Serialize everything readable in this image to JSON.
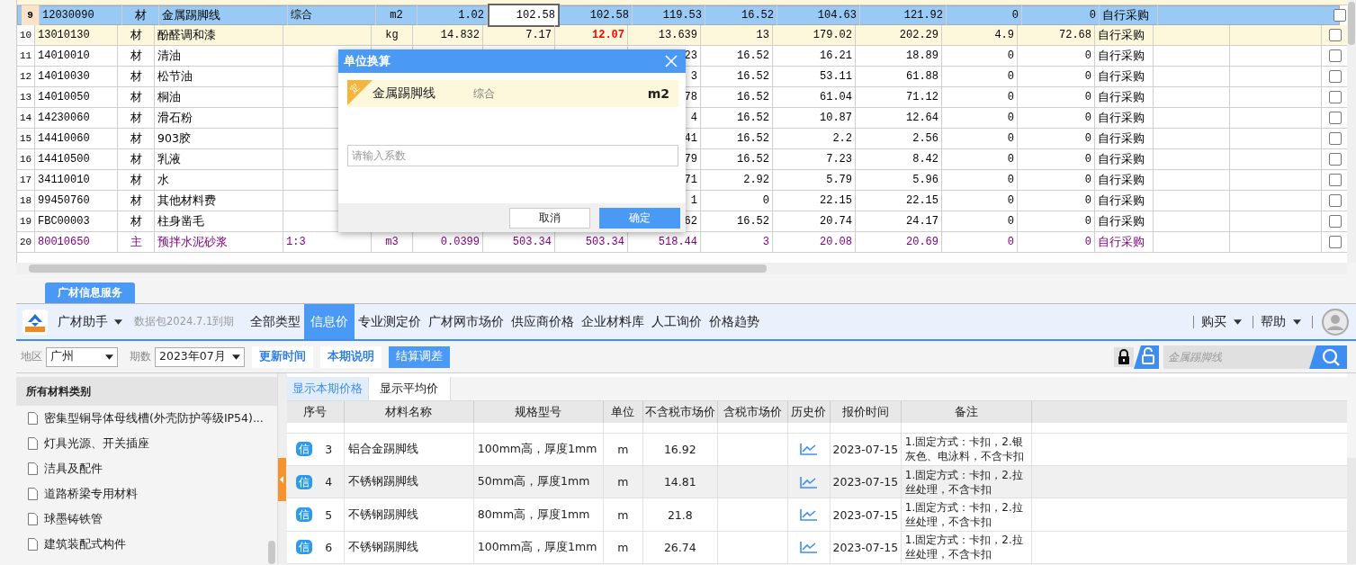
{
  "grid": {
    "rows": [
      {
        "no": "9",
        "code": "12030090",
        "type": "材",
        "kind": "material",
        "name": "金属踢脚线",
        "spec": "综合",
        "unit": "m2",
        "qty": "1.02",
        "c1": "102.58",
        "c2": "102.58",
        "c3": "119.53",
        "c4": "16.52",
        "c5": "104.63",
        "c6": "121.92",
        "c7": "0",
        "c8": "0",
        "source": "自行采购",
        "selected": true,
        "editing": true,
        "changed": false,
        "checked": false
      },
      {
        "no": "10",
        "code": "13010130",
        "type": "材",
        "kind": "material",
        "name": "酚醛调和漆",
        "unit": "kg",
        "qty": "14.832",
        "c1": "7.17",
        "c2": "12.07",
        "c3": "13.639",
        "c4": "13",
        "c5": "179.02",
        "c6": "202.29",
        "c7": "4.9",
        "c8": "72.68",
        "source": "自行采购",
        "selected": false,
        "editing": false,
        "changed": true,
        "checked": false
      },
      {
        "no": "11",
        "code": "14010010",
        "type": "材",
        "kind": "material",
        "name": "清油",
        "c3": "23",
        "c4": "16.52",
        "c5": "16.21",
        "c6": "18.89",
        "c7": "0",
        "c8": "0",
        "source": "自行采购",
        "selected": false,
        "editing": false,
        "changed": false,
        "checked": false
      },
      {
        "no": "12",
        "code": "14010030",
        "type": "材",
        "kind": "material",
        "name": "松节油",
        "c3": "3",
        "c4": "16.52",
        "c5": "53.11",
        "c6": "61.88",
        "c7": "0",
        "c8": "0",
        "source": "自行采购",
        "selected": false,
        "editing": false,
        "changed": false,
        "checked": false
      },
      {
        "no": "13",
        "code": "14010050",
        "type": "材",
        "kind": "material",
        "name": "桐油",
        "c3": "78",
        "c4": "16.52",
        "c5": "61.04",
        "c6": "71.12",
        "c7": "0",
        "c8": "0",
        "source": "自行采购",
        "selected": false,
        "editing": false,
        "changed": false,
        "checked": false
      },
      {
        "no": "14",
        "code": "14230060",
        "type": "材",
        "kind": "material",
        "name": "滑石粉",
        "c3": "4",
        "c4": "16.52",
        "c5": "10.87",
        "c6": "12.64",
        "c7": "0",
        "c8": "0",
        "source": "自行采购",
        "selected": false,
        "editing": false,
        "changed": false,
        "checked": false
      },
      {
        "no": "15",
        "code": "14410060",
        "type": "材",
        "kind": "material",
        "name": "903胶",
        "c3": "41",
        "c4": "16.52",
        "c5": "2.2",
        "c6": "2.56",
        "c7": "0",
        "c8": "0",
        "source": "自行采购",
        "selected": false,
        "editing": false,
        "changed": false,
        "checked": false
      },
      {
        "no": "16",
        "code": "14410500",
        "type": "材",
        "kind": "material",
        "name": "乳液",
        "c3": "79",
        "c4": "16.52",
        "c5": "7.23",
        "c6": "8.42",
        "c7": "0",
        "c8": "0",
        "source": "自行采购",
        "selected": false,
        "editing": false,
        "changed": false,
        "checked": false
      },
      {
        "no": "17",
        "code": "34110010",
        "type": "材",
        "kind": "material",
        "name": "水",
        "c3": "71",
        "c4": "2.92",
        "c5": "5.79",
        "c6": "5.96",
        "c7": "0",
        "c8": "0",
        "source": "自行采购",
        "selected": false,
        "editing": false,
        "changed": false,
        "checked": false
      },
      {
        "no": "18",
        "code": "99450760",
        "type": "材",
        "kind": "material",
        "name": "其他材料费",
        "c3": "1",
        "c4": "0",
        "c5": "22.15",
        "c6": "22.15",
        "c7": "0",
        "c8": "0",
        "source": "自行采购",
        "selected": false,
        "editing": false,
        "changed": false,
        "checked": false
      },
      {
        "no": "19",
        "code": "FBC00003",
        "type": "材",
        "kind": "material",
        "name": "柱身凿毛",
        "c3": "62",
        "c4": "16.52",
        "c5": "20.74",
        "c6": "24.17",
        "c7": "0",
        "c8": "0",
        "source": "自行采购",
        "selected": false,
        "editing": false,
        "changed": false,
        "checked": false
      },
      {
        "no": "20",
        "code": "80010650",
        "type": "主",
        "kind": "main",
        "name": "预拌水泥砂浆",
        "spec": "1:3",
        "unit": "m3",
        "qty": "0.0399",
        "c1": "503.34",
        "c2": "503.34",
        "c3": "518.44",
        "c4": "3",
        "c5": "20.08",
        "c6": "20.69",
        "c7": "0",
        "c8": "0",
        "source": "自行采购",
        "selected": false,
        "editing": false,
        "changed": false,
        "checked": false
      }
    ]
  },
  "dialog": {
    "title": "单位换算",
    "tag": "定",
    "name": "金属踢脚线",
    "spec": "综合",
    "unit": "m2",
    "placeholder": "请输入系数",
    "buttons": [
      {
        "label": "取消",
        "primary": false
      },
      {
        "label": "确定",
        "primary": true
      }
    ]
  },
  "service": {
    "tab": "广材信息服务",
    "app_name": "广材助手",
    "package_note": "数据包2024.7.1到期",
    "nav": [
      {
        "label": "全部类型",
        "selected": false
      },
      {
        "label": "信息价",
        "selected": true
      },
      {
        "label": "专业测定价",
        "selected": false
      },
      {
        "label": "广材网市场价",
        "selected": false
      },
      {
        "label": "供应商价格",
        "selected": false
      },
      {
        "label": "企业材料库",
        "selected": false
      },
      {
        "label": "人工询价",
        "selected": false
      },
      {
        "label": "价格趋势",
        "selected": false
      }
    ],
    "menus": [
      "购买",
      "帮助"
    ],
    "region_label": "地区",
    "region": "广州",
    "period_label": "期数",
    "period": "2023年07月",
    "actions": [
      {
        "label": "更新时间",
        "selected": false
      },
      {
        "label": "本期说明",
        "selected": false
      },
      {
        "label": "结算调差",
        "selected": true
      }
    ],
    "search": {
      "placeholder": "金属踢脚线"
    }
  },
  "categories": {
    "header": "所有材料类别",
    "items": [
      "密集型铜导体母线槽(外壳防护等级IP54)...",
      "灯具光源、开关插座",
      "洁具及配件",
      "道路桥梁专用材料",
      "球墨铸铁管",
      "建筑装配式构件"
    ]
  },
  "prices": {
    "tabs": [
      {
        "label": "显示本期价格",
        "selected": true
      },
      {
        "label": "显示平均价",
        "selected": false
      }
    ],
    "columns": [
      "序号",
      "材料名称",
      "规格型号",
      "单位",
      "不含税市场价",
      "含税市场价",
      "历史价",
      "报价时间",
      "备注"
    ],
    "rows": [
      {
        "badge": "信",
        "no": "3",
        "name": "铝合金踢脚线",
        "spec": "100mm高，厚度1mm",
        "unit": "m",
        "price": "16.92",
        "date": "2023-07-15",
        "note": "1.固定方式：卡扣，2.银灰色、电泳料，不含卡扣",
        "selected": false
      },
      {
        "badge": "信",
        "no": "4",
        "name": "不锈钢踢脚线",
        "spec": "50mm高，厚度1mm",
        "unit": "m",
        "price": "14.81",
        "date": "2023-07-15",
        "note": "1.固定方式：卡扣，2.拉丝处理，不含卡扣",
        "selected": true
      },
      {
        "badge": "信",
        "no": "5",
        "name": "不锈钢踢脚线",
        "spec": "80mm高，厚度1mm",
        "unit": "m",
        "price": "21.8",
        "date": "2023-07-15",
        "note": "1.固定方式：卡扣，2.拉丝处理，不含卡扣",
        "selected": false
      },
      {
        "badge": "信",
        "no": "6",
        "name": "不锈钢踢脚线",
        "spec": "100mm高，厚度1mm",
        "unit": "m",
        "price": "26.74",
        "date": "2023-07-15",
        "note": "1.固定方式：卡扣，2.拉丝处理，不含卡扣",
        "selected": false
      }
    ]
  }
}
